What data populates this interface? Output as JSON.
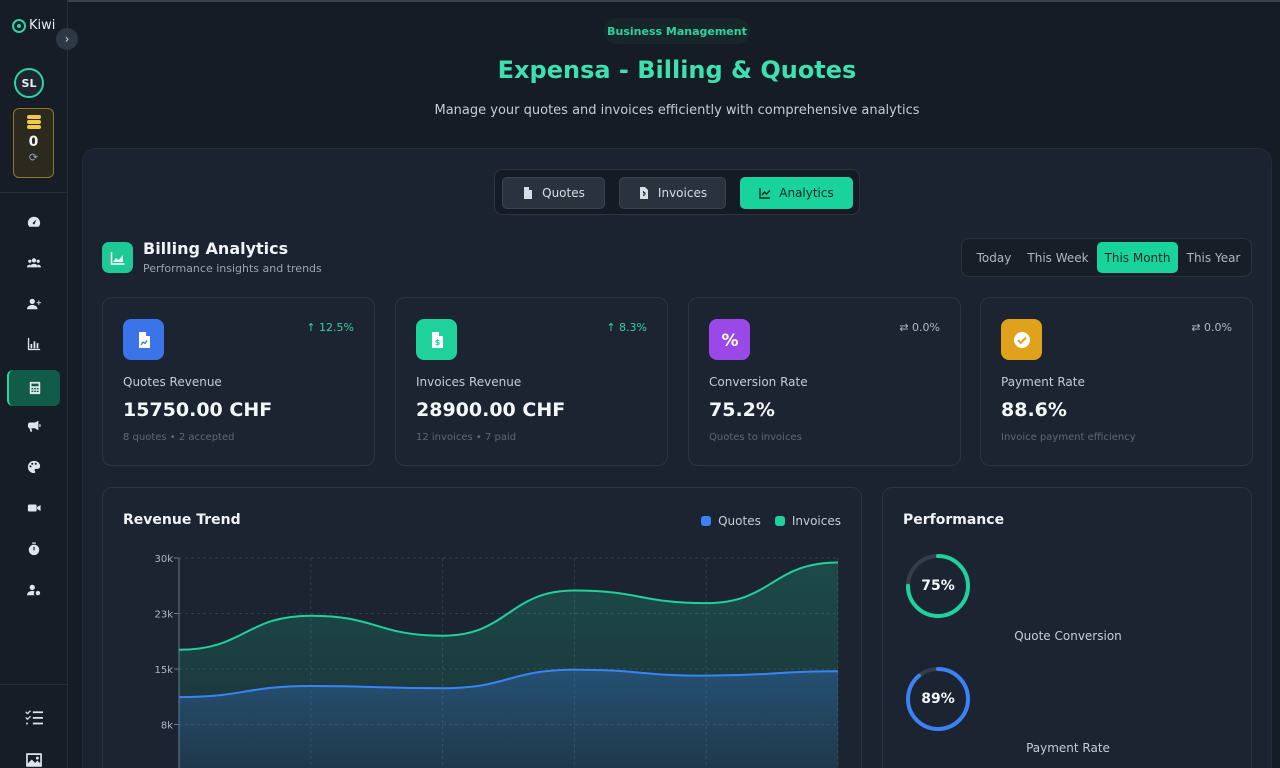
{
  "sidebar": {
    "brand": "Kiwi",
    "avatar_initials": "SL",
    "credits": "0",
    "nav": [
      {
        "name": "dashboard",
        "icon": "gauge-icon"
      },
      {
        "name": "team",
        "icon": "users-icon"
      },
      {
        "name": "add-user",
        "icon": "user-plus-icon"
      },
      {
        "name": "reports",
        "icon": "bar-chart-icon"
      },
      {
        "name": "billing",
        "icon": "calculator-icon",
        "active": true
      },
      {
        "name": "campaigns",
        "icon": "megaphone-icon"
      },
      {
        "name": "design",
        "icon": "palette-icon"
      },
      {
        "name": "video",
        "icon": "video-icon"
      },
      {
        "name": "timer",
        "icon": "stopwatch-icon"
      },
      {
        "name": "user-settings",
        "icon": "user-cog-icon"
      },
      {
        "name": "tasks",
        "icon": "checklist-icon"
      },
      {
        "name": "gallery",
        "icon": "image-icon"
      }
    ]
  },
  "header": {
    "eyebrow": "Business Management",
    "title": "Expensa - Billing & Quotes",
    "subtitle": "Manage your quotes and invoices efficiently with comprehensive analytics"
  },
  "tabs": [
    {
      "label": "Quotes",
      "active": false
    },
    {
      "label": "Invoices",
      "active": false
    },
    {
      "label": "Analytics",
      "active": true
    }
  ],
  "analytics": {
    "title": "Billing Analytics",
    "subtitle": "Performance insights and trends",
    "periods": [
      "Today",
      "This Week",
      "This Month",
      "This Year"
    ],
    "active_period": "This Month"
  },
  "cards": [
    {
      "label": "Quotes Revenue",
      "value": "15750.00 CHF",
      "meta": "8 quotes • 2 accepted",
      "trend": "↑ 12.5%",
      "trend_color": "#2fd3a0",
      "color": "#3b74e8"
    },
    {
      "label": "Invoices Revenue",
      "value": "28900.00 CHF",
      "meta": "12 invoices • 7 paid",
      "trend": "↑ 8.3%",
      "trend_color": "#2fd3a0",
      "color": "#1fd29c"
    },
    {
      "label": "Conversion Rate",
      "value": "75.2%",
      "meta": "Quotes to invoices",
      "trend": "⇄ 0.0%",
      "trend_color": "#aeb7c1",
      "color": "#9a49e8"
    },
    {
      "label": "Payment Rate",
      "value": "88.6%",
      "meta": "Invoice payment efficiency",
      "trend": "⇄ 0.0%",
      "trend_color": "#aeb7c1",
      "color": "#e0a21a"
    }
  ],
  "chart_data": {
    "type": "area",
    "title": "Revenue Trend",
    "ylim": [
      0,
      30000
    ],
    "yticks": [
      {
        "value": 30000,
        "label": "30k"
      },
      {
        "value": 22500,
        "label": "23k"
      },
      {
        "value": 15000,
        "label": "15k"
      },
      {
        "value": 7500,
        "label": "8k"
      }
    ],
    "x": [
      0,
      1,
      2,
      3,
      4,
      5
    ],
    "grid": true,
    "legend": "top-right",
    "series": [
      {
        "name": "Quotes",
        "color": "#3b82f6",
        "values": [
          11200,
          12700,
          12400,
          14900,
          14100,
          14700
        ]
      },
      {
        "name": "Invoices",
        "color": "#1fd29c",
        "values": [
          17600,
          22200,
          19500,
          25600,
          23900,
          29400
        ]
      }
    ]
  },
  "performance": {
    "title": "Performance",
    "items": [
      {
        "value": "75%",
        "fraction": 0.75,
        "label": "Quote Conversion",
        "color": "#1fd29c"
      },
      {
        "value": "89%",
        "fraction": 0.89,
        "label": "Payment Rate",
        "color": "#3b82f6"
      }
    ]
  }
}
